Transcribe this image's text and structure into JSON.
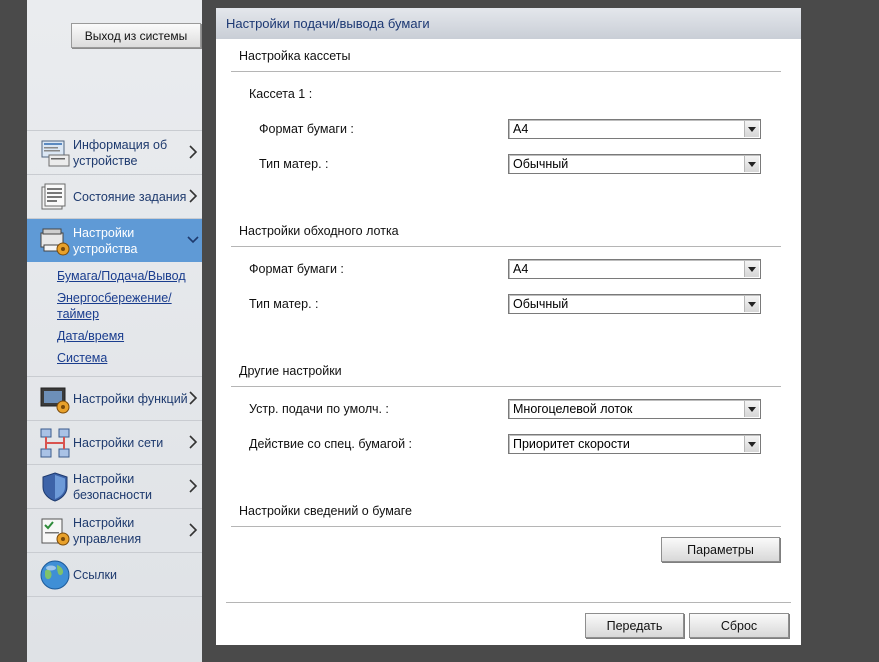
{
  "sidebar": {
    "logout_label": "Выход из системы",
    "items": [
      {
        "icon": "device-info-icon",
        "label": "Информация об устройстве"
      },
      {
        "icon": "job-status-icon",
        "label": "Состояние задания"
      },
      {
        "icon": "device-settings-icon",
        "label": "Настройки устройства"
      },
      {
        "icon": "function-settings-icon",
        "label": "Настройки функций"
      },
      {
        "icon": "network-icon",
        "label": "Настройки сети"
      },
      {
        "icon": "shield-icon",
        "label": "Настройки безопасности"
      },
      {
        "icon": "management-icon",
        "label": "Настройки управления"
      },
      {
        "icon": "globe-icon",
        "label": "Ссылки"
      }
    ],
    "active_index": 2,
    "submenu": [
      "Бумага/Подача/Вывод",
      "Энергосбережение/таймер",
      "Дата/время",
      "Система"
    ]
  },
  "panel": {
    "title": "Настройки подачи/вывода бумаги",
    "cassette": {
      "heading": "Настройка кассеты",
      "cassette1": "Кассета 1 :",
      "paper_size_label": "Формат бумаги :",
      "paper_size_value": "A4",
      "media_type_label": "Тип матер. :",
      "media_type_value": "Обычный"
    },
    "bypass": {
      "heading": "Настройки обходного лотка",
      "paper_size_label": "Формат бумаги :",
      "paper_size_value": "A4",
      "media_type_label": "Тип матер. :",
      "media_type_value": "Обычный"
    },
    "other": {
      "heading": "Другие настройки",
      "default_feed_label": "Устр. подачи по умолч. :",
      "default_feed_value": "Многоцелевой лоток",
      "special_paper_label": "Действие со спец. бумагой :",
      "special_paper_value": "Приоритет скорости"
    },
    "paper_info": {
      "heading": "Настройки сведений о бумаге",
      "params_button": "Параметры"
    },
    "submit_button": "Передать",
    "reset_button": "Сброс"
  },
  "colors": {
    "active_menu": "#5f9ad6",
    "menu_text": "#1e3a6e",
    "link": "#1a3d8e",
    "title_text": "#1c3873"
  }
}
